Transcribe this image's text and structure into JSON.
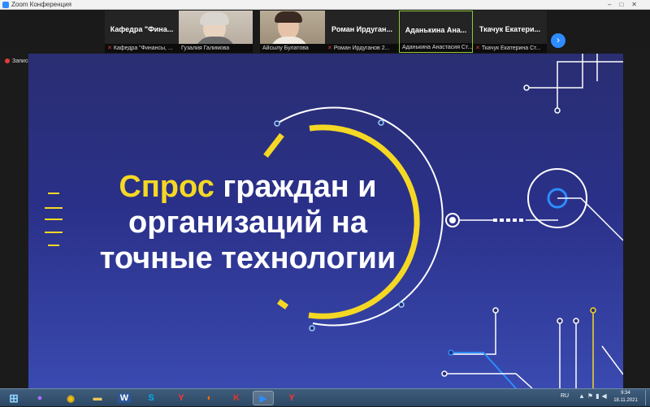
{
  "window": {
    "title": "Zoom Конференция"
  },
  "participants": [
    {
      "display_name": "Кафедра \"Фина...",
      "footer": "Кафедра \"Финансы, ...",
      "video": false,
      "active": false
    },
    {
      "display_name": "",
      "footer": "Гузалия Галимова",
      "video": true,
      "active": false
    },
    {
      "display_name": "",
      "footer": "Айсылу Булатова",
      "video": true,
      "active": false
    },
    {
      "display_name": "Роман Ирдуган...",
      "footer": "Роман Ирдуганов 2...",
      "video": false,
      "active": false
    },
    {
      "display_name": "Аданькина Ана...",
      "footer": "Аданькина Анастасия Ст...",
      "video": false,
      "active": true
    },
    {
      "display_name": "Ткачук Екатери...",
      "footer": "Ткачук Екатерина Ст...",
      "video": false,
      "active": false
    }
  ],
  "next_icon": "chevron-right-icon",
  "recording": {
    "label": "Запись"
  },
  "slide": {
    "title_accent": "Спрос",
    "title_rest": " граждан и организаций на точные технологии",
    "colors": {
      "accent": "#f5d824",
      "background": "#2a3088"
    }
  },
  "taskbar": {
    "apps": [
      {
        "icon": "windows-start-icon",
        "glyph": "⊞",
        "color": "#8fd0ff"
      },
      {
        "icon": "alice-icon",
        "glyph": "●",
        "color": "#a86bff"
      },
      {
        "icon": "chrome-icon",
        "glyph": "◉",
        "color": "#f4c20d"
      },
      {
        "icon": "folder-icon",
        "glyph": "▬",
        "color": "#f1c75b"
      },
      {
        "icon": "word-icon",
        "glyph": "W",
        "color": "#2b5797"
      },
      {
        "icon": "skype-icon",
        "glyph": "S",
        "color": "#00aff0"
      },
      {
        "icon": "yandex-browser-icon",
        "glyph": "Y",
        "color": "#ff3333"
      },
      {
        "icon": "media-icon",
        "glyph": "◐",
        "color": "#ff6a00"
      },
      {
        "icon": "kaspersky-icon",
        "glyph": "K",
        "color": "#e3342f"
      },
      {
        "icon": "zoom-icon",
        "glyph": "▶",
        "color": "#2d8cff"
      },
      {
        "icon": "yandex-icon",
        "glyph": "Y",
        "color": "#ff3333"
      }
    ],
    "language": "RU",
    "time": "9:34",
    "date": "18.11.2021"
  }
}
